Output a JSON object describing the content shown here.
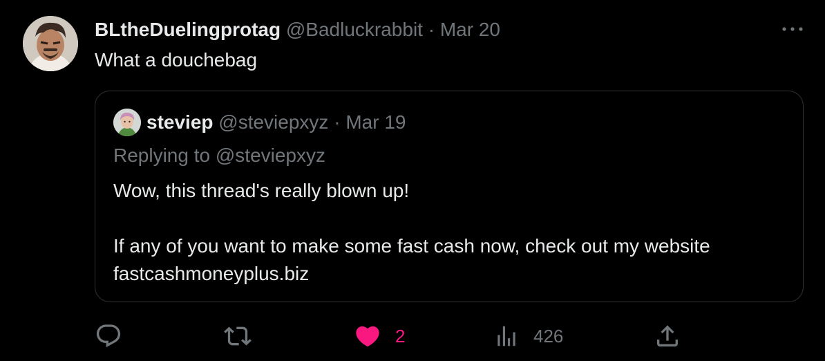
{
  "tweet": {
    "display_name": "BLtheDuelingprotag",
    "handle": "@Badluckrabbit",
    "separator": "·",
    "date": "Mar 20",
    "text": "What a douchebag"
  },
  "quoted_tweet": {
    "display_name": "steviep",
    "handle": "@steviepxyz",
    "separator": "·",
    "date": "Mar 19",
    "replying_to": "Replying to @steviepxyz",
    "lines": [
      "Wow, this thread's really blown up!",
      "If any of you want to make some fast cash now, check out my website",
      "fastcashmoneyplus.biz"
    ]
  },
  "actions": {
    "likes": "2",
    "views": "426"
  },
  "icons": {
    "reply": "reply-icon",
    "retweet": "retweet-icon",
    "like": "heart-icon",
    "views": "views-chart-icon",
    "share": "share-icon",
    "more": "more-options-icon"
  },
  "colors": {
    "background": "#000000",
    "text": "#e7e9ea",
    "muted": "#71767b",
    "like": "#f91880",
    "border": "#2f3336"
  }
}
